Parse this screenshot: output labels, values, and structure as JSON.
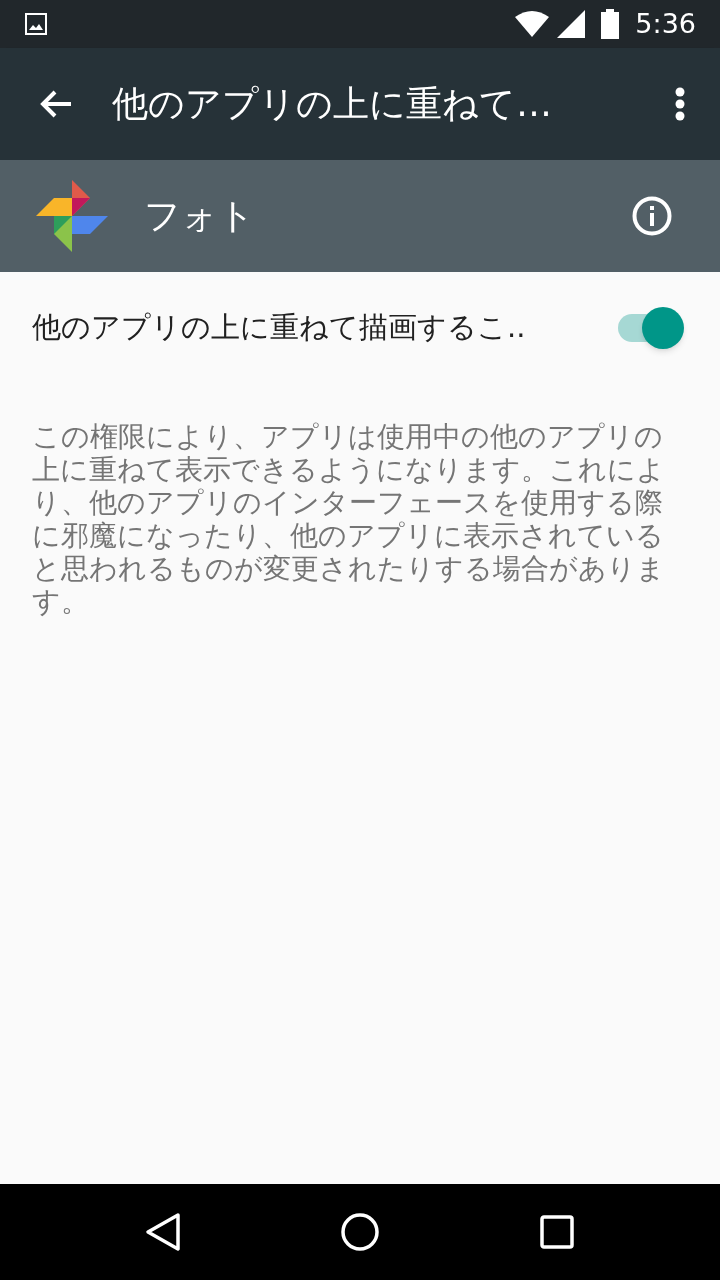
{
  "status_bar": {
    "time": "5:36"
  },
  "app_bar": {
    "title": "他のアプリの上に重ねて…"
  },
  "app_header": {
    "name": "フォト"
  },
  "setting": {
    "label": "他のアプリの上に重ねて描画するこ..",
    "on": true
  },
  "description": "この権限により、アプリは使用中の他のアプリの上に重ねて表示できるようになります。これにより、他のアプリのインターフェースを使用する際に邪魔になったり、他のアプリに表示されていると思われるものが変更されたりする場合があります。"
}
